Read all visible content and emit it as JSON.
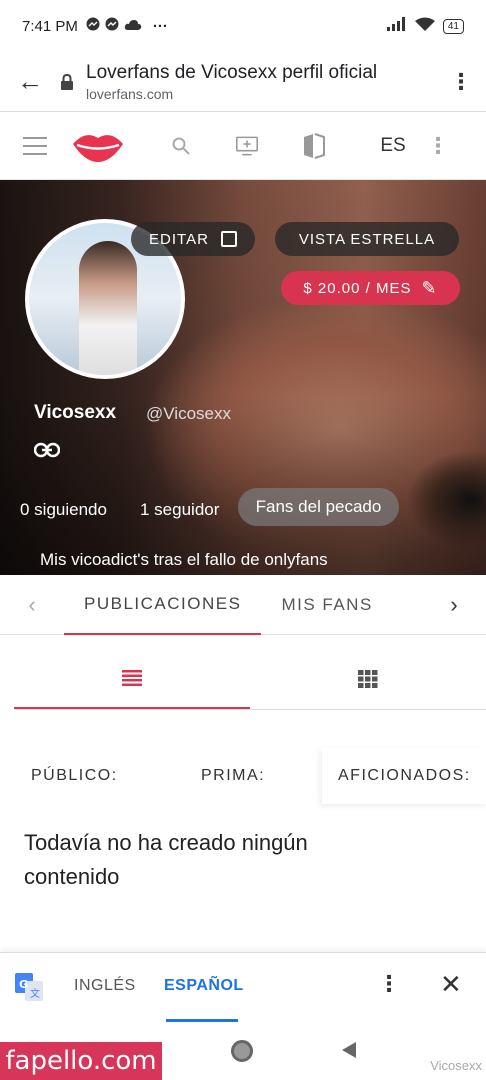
{
  "status_bar": {
    "time": "7:41 PM",
    "dots": "···",
    "battery": "41"
  },
  "browser": {
    "page_title": "Loverfans de Vicosexx perfil oficial",
    "url": "loverfans.com"
  },
  "toolbar": {
    "language": "ES"
  },
  "profile": {
    "edit_label": "EDITAR",
    "star_view_label": "VISTA ESTRELLA",
    "price_label": "$ 20.00 / MES",
    "name": "Vicosexx",
    "handle": "@Vicosexx",
    "following": "0 siguiendo",
    "followers": "1 seguidor",
    "fans_badge": "Fans del pecado",
    "bio": "Mis vicoadict's tras el fallo de onlyfans"
  },
  "tabs": [
    "PUBLICACIONES",
    "MIS FANS"
  ],
  "filters": [
    "PÚBLICO:",
    "PRIMA:",
    "AFICIONADOS:"
  ],
  "empty_message": "Todavía no ha creado ningún contenido",
  "translate": {
    "from": "INGLÉS",
    "to": "ESPAÑOL"
  },
  "watermark": {
    "brand": "fapello.com",
    "user": "Vicosexx"
  },
  "colors": {
    "accent": "#d8344f",
    "link_blue": "#1a73e8"
  }
}
